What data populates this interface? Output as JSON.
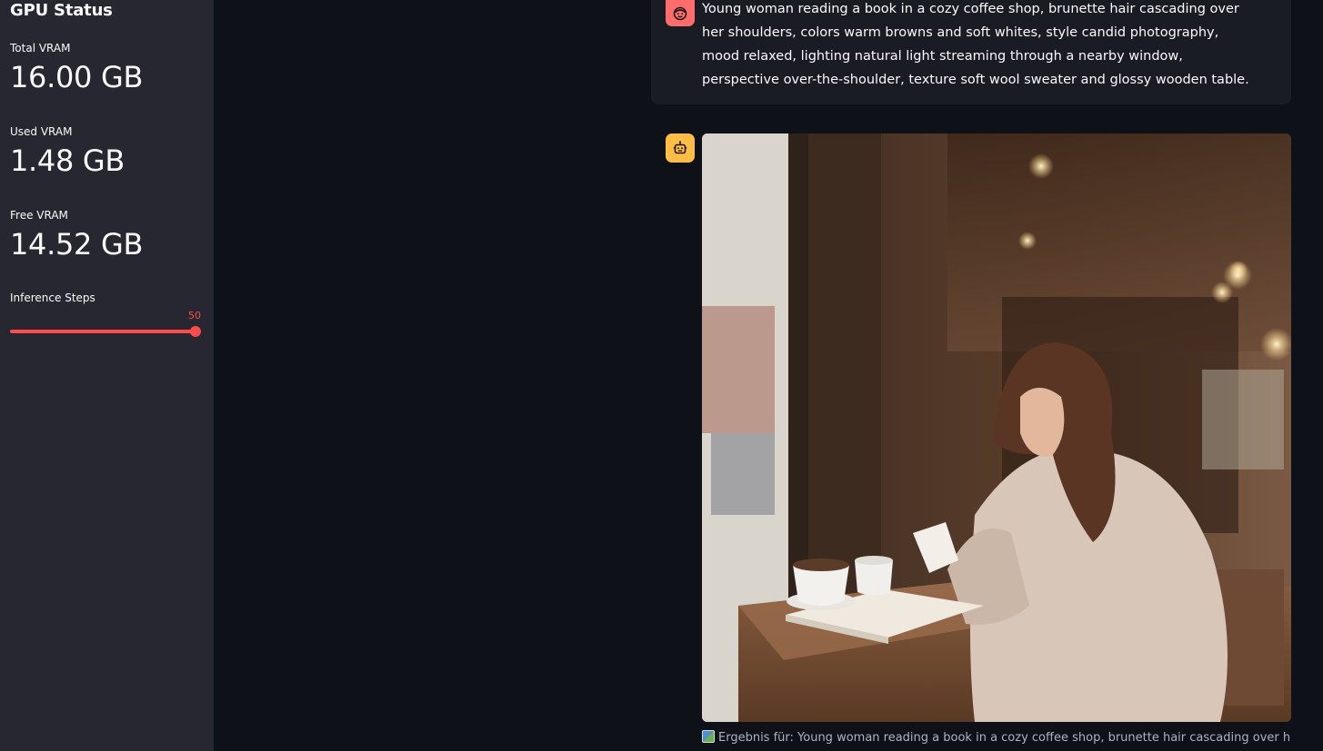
{
  "sidebar": {
    "title": "GPU Status",
    "metrics": [
      {
        "label": "Total VRAM",
        "value": "16.00 GB"
      },
      {
        "label": "Used VRAM",
        "value": "1.48 GB"
      },
      {
        "label": "Free VRAM",
        "value": "14.52 GB"
      }
    ],
    "slider": {
      "label": "Inference Steps",
      "value": "50",
      "fill_fraction": 1.0
    }
  },
  "chat": {
    "user_prompt": "Young woman reading a book in a cozy coffee shop, brunette hair cascading over her shoulders, colors warm browns and soft whites, style candid photography, mood relaxed, lighting natural light streaming through a nearby window, perspective over-the-shoulder, texture soft wool sweater and glossy wooden table.",
    "user_avatar_icon": "face-icon",
    "bot_avatar_icon": "robot-icon",
    "caption": "Ergebnis für: Young woman reading a book in a cozy coffee shop, brunette hair cascading over her"
  },
  "colors": {
    "accent": "#ff4b4b",
    "user_avatar_bg": "#ff6c6c",
    "bot_avatar_bg": "#ffbd45",
    "app_bg": "#0e1117",
    "sidebar_bg": "#262730"
  }
}
